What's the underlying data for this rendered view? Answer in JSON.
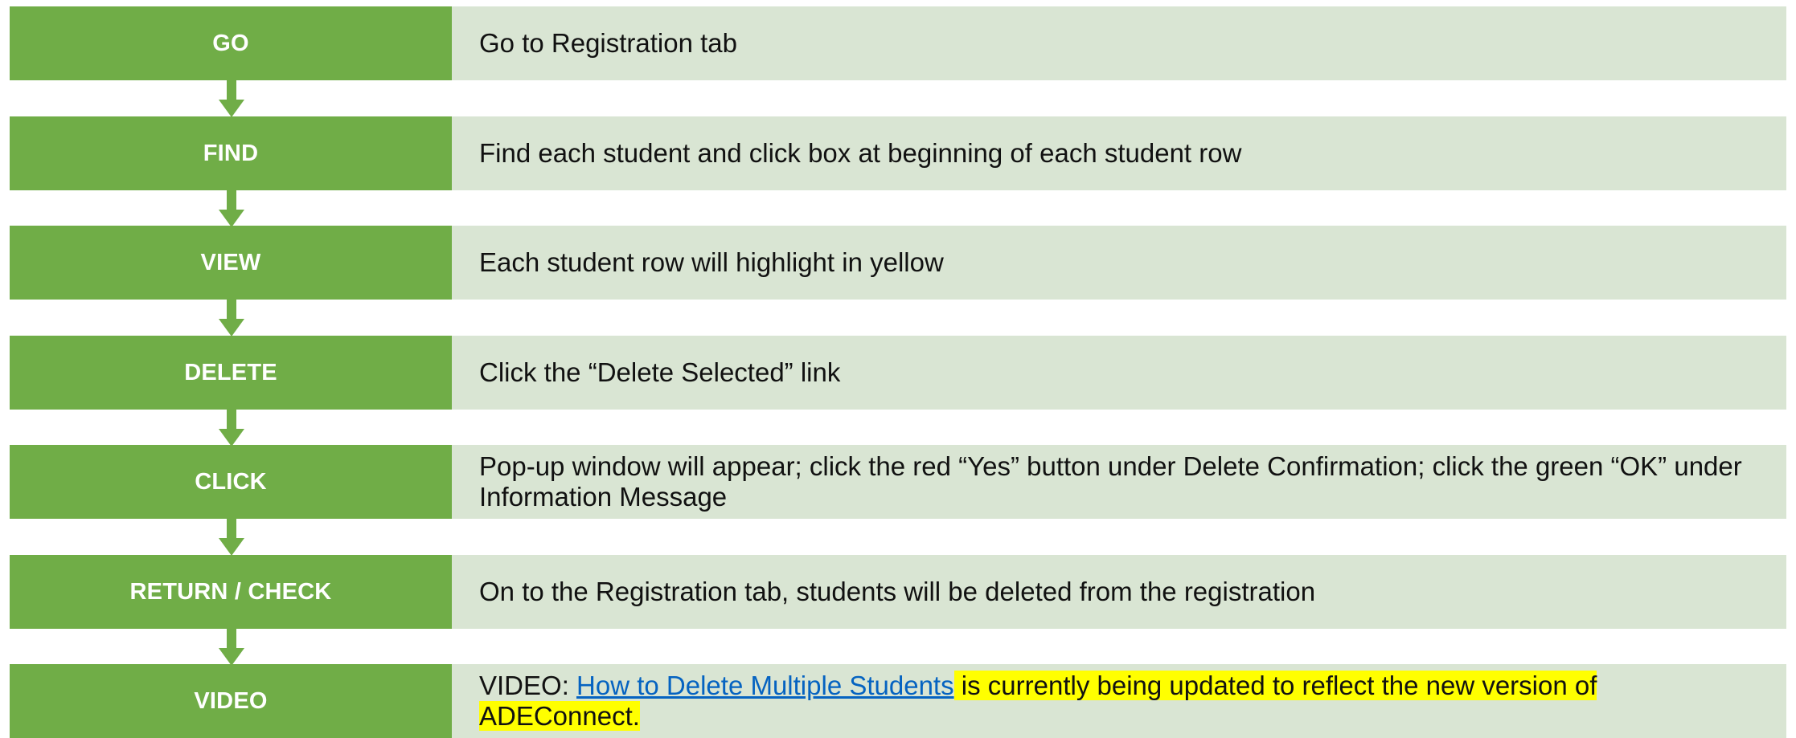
{
  "steps": [
    {
      "label": "GO",
      "description": "Go to Registration tab"
    },
    {
      "label": "FIND",
      "description": "Find each student and click box at beginning of each student row"
    },
    {
      "label": "VIEW",
      "description": "Each student row will highlight in yellow"
    },
    {
      "label": "DELETE",
      "description": "Click the “Delete Selected” link"
    },
    {
      "label": "CLICK",
      "description": "Pop-up window will appear; click the red “Yes” button under Delete Confirmation; click the green “OK” under Information Message"
    },
    {
      "label": "RETURN / CHECK",
      "description": "On to the Registration tab, students will be deleted from the registration"
    }
  ],
  "video": {
    "label": "VIDEO",
    "prefix": "VIDEO: ",
    "link_text": "How to Delete Multiple Students",
    "highlight_text": " is currently being updated to reflect the new version of ADEConnect."
  },
  "colors": {
    "label_fill": "#70ad47",
    "description_fill": "#d9e5d3",
    "link": "#0563c1",
    "highlight": "#ffff00"
  }
}
